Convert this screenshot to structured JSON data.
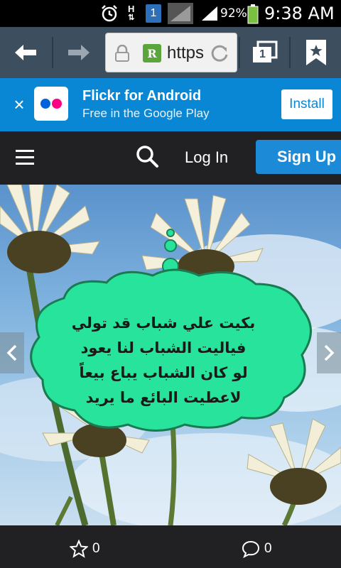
{
  "status_bar": {
    "network_h": "H",
    "sim_badge": "1",
    "battery_percent": "92%",
    "time": "9:38 AM"
  },
  "browser": {
    "url": "https",
    "tabs_count": "1",
    "favicon_letter": "R"
  },
  "banner": {
    "title": "Flickr for Android",
    "subtitle": "Free in the Google Play",
    "install_label": "Install",
    "close_glyph": "×",
    "brand_colors": {
      "blue": "#0063dc",
      "pink": "#ff0084"
    }
  },
  "site_header": {
    "login_label": "Log In",
    "signup_label": "Sign Up"
  },
  "photo": {
    "quote_lines": [
      "بكيت علي شباب قد تولي",
      "فياليت الشباب لنا يعود",
      "لو كان الشباب يباع بيعاً",
      "لاعطيت البائع ما يريد"
    ],
    "bubble_color": "#28e39b"
  },
  "bottom_bar": {
    "favorites_count": "0",
    "comments_count": "0"
  }
}
